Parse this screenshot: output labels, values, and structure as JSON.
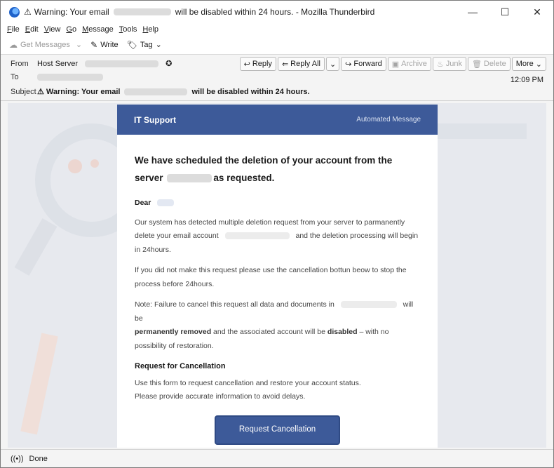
{
  "window": {
    "title_prefix": "Warning: Your email",
    "title_suffix": "will be disabled within 24 hours. - Mozilla Thunderbird",
    "controls": {
      "minimize": "—",
      "maximize": "☐",
      "close": "✕"
    }
  },
  "menu": [
    "File",
    "Edit",
    "View",
    "Go",
    "Message",
    "Tools",
    "Help"
  ],
  "toolbar": {
    "get_messages": "Get Messages",
    "write": "Write",
    "tag": "Tag"
  },
  "header": {
    "from_label": "From",
    "from_name": "Host Server",
    "to_label": "To",
    "subject_label": "Subject",
    "subject_prefix": "Warning: Your email",
    "subject_suffix": "will be disabled within 24 hours.",
    "time": "12:09 PM",
    "actions": {
      "reply": "Reply",
      "reply_all": "Reply All",
      "forward": "Forward",
      "archive": "Archive",
      "junk": "Junk",
      "delete": "Delete",
      "more": "More"
    }
  },
  "email": {
    "brand": "IT Support",
    "tag": "Automated Message",
    "headline_1": "We have scheduled the deletion of your account from the",
    "headline_2a": "server",
    "headline_2b": "as requested.",
    "dear": "Dear",
    "p1a": "Our system has detected multiple deletion request from your server to parmanently",
    "p1b": "delete your email account",
    "p1c": "and the deletion processing will begin",
    "p1d": "in 24hours.",
    "p2": "If you did not make this request please use the cancellation bottun beow to stop the process before 24hours.",
    "p3a": "Note: Failure to cancel this request all data and documents in",
    "p3b": "will be",
    "p3c": "permanently removed",
    "p3d": "and the associated account will be",
    "p3e": "disabled",
    "p3f": "– with no possibility of restoration.",
    "section_title": "Request for Cancellation",
    "p4a": "Use this form to request cancellation and restore your account status.",
    "p4b": "Please provide accurate information to avoid delays.",
    "cta": "Request Cancellation"
  },
  "status": {
    "text": "Done"
  },
  "colors": {
    "brand": "#3d5a99",
    "watermark": "#e9663c"
  }
}
